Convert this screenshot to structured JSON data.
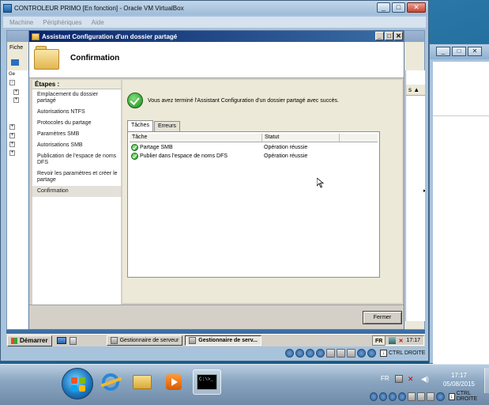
{
  "host": {
    "taskbar": {
      "language": "FR",
      "time": "17:17",
      "date": "05/08/2015",
      "status_key": "CTRL DROITE"
    },
    "cmd_text": "C:\\>_"
  },
  "vbox": {
    "title": "CONTROLEUR PRIMO [En fonction] - Oracle VM VirtualBox",
    "menu": [
      "Machine",
      "Périphériques",
      "Aide"
    ],
    "status_key": "CTRL DROITE"
  },
  "guest": {
    "menu_fragment": "Fiche",
    "tree_fragment": "Ge",
    "right_header": "s"
  },
  "wizard": {
    "title": "Assistant Configuration d'un dossier partagé",
    "heading": "Confirmation",
    "steps_header": "Étapes :",
    "steps": [
      "Emplacement du dossier partagé",
      "Autorisations NTFS",
      "Protocoles du partage",
      "Paramètres SMB",
      "Autorisations SMB",
      "Publication de l'espace de noms DFS",
      "Revoir les paramètres et créer le partage",
      "Confirmation"
    ],
    "current_step_index": 7,
    "success_message": "Vous avez terminé l'Assistant Configuration d'un dossier partagé avec succès.",
    "tabs": [
      "Tâches",
      "Erreurs"
    ],
    "active_tab": "Tâches",
    "columns": [
      "Tâche",
      "Statut"
    ],
    "rows": [
      {
        "task": "Partage SMB",
        "status": "Opération réussie"
      },
      {
        "task": "Publier dans l'espace de noms DFS",
        "status": "Opération réussie"
      }
    ],
    "close_button": "Fermer"
  },
  "guest_taskbar": {
    "start_label": "Démarrer",
    "tasks": [
      "Gestionnaire de serveur",
      "Gestionnaire de serv..."
    ],
    "language": "FR",
    "time": "17:17"
  }
}
